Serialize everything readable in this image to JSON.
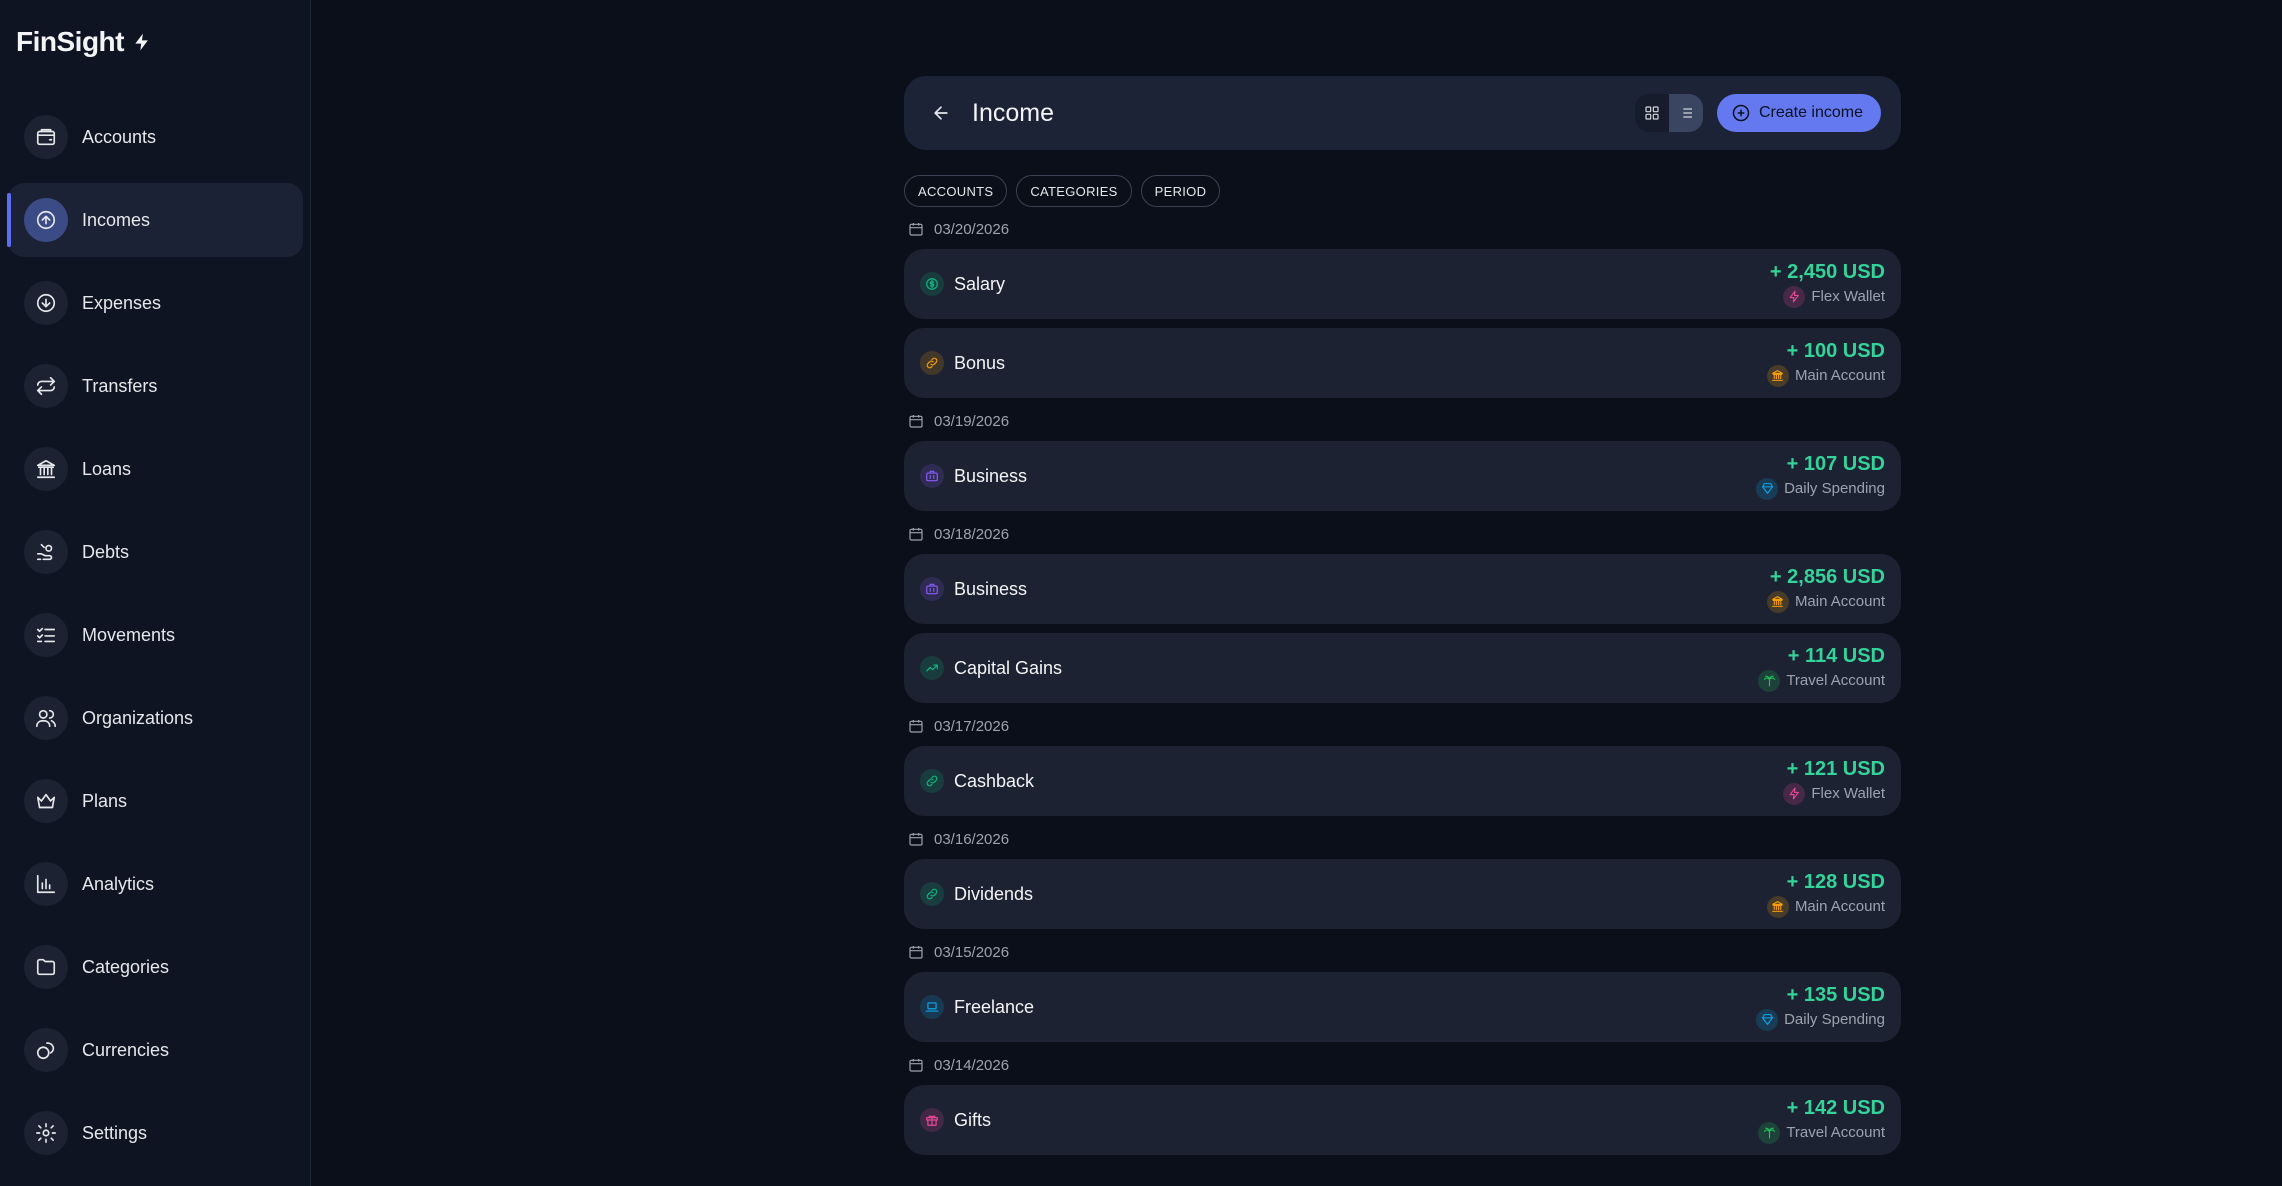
{
  "app": {
    "name": "FinSight"
  },
  "sidebar": {
    "items": [
      {
        "label": "Accounts",
        "icon": "wallet-icon",
        "active": false
      },
      {
        "label": "Incomes",
        "icon": "arrow-up-circle-icon",
        "active": true
      },
      {
        "label": "Expenses",
        "icon": "arrow-down-circle-icon",
        "active": false
      },
      {
        "label": "Transfers",
        "icon": "transfer-icon",
        "active": false
      },
      {
        "label": "Loans",
        "icon": "bank-icon",
        "active": false
      },
      {
        "label": "Debts",
        "icon": "hand-coins-icon",
        "active": false
      },
      {
        "label": "Movements",
        "icon": "list-checks-icon",
        "active": false
      },
      {
        "label": "Organizations",
        "icon": "users-icon",
        "active": false
      },
      {
        "label": "Plans",
        "icon": "crown-icon",
        "active": false
      },
      {
        "label": "Analytics",
        "icon": "bar-chart-icon",
        "active": false
      },
      {
        "label": "Categories",
        "icon": "folder-icon",
        "active": false
      },
      {
        "label": "Currencies",
        "icon": "coins-icon",
        "active": false
      },
      {
        "label": "Settings",
        "icon": "gear-icon",
        "active": false
      }
    ]
  },
  "header": {
    "title": "Income",
    "create_label": "Create income",
    "view_mode": "list"
  },
  "filters": [
    "ACCOUNTS",
    "CATEGORIES",
    "PERIOD"
  ],
  "groups": [
    {
      "date": "03/20/2026",
      "items": [
        {
          "name": "Salary",
          "amount": "+ 2,450 USD",
          "account": "Flex Wallet",
          "cat_icon": "dollar-icon",
          "cat_color": "#10b981",
          "acc_icon": "zap-icon",
          "acc_color": "#ec4899"
        },
        {
          "name": "Bonus",
          "amount": "+ 100 USD",
          "account": "Main Account",
          "cat_icon": "link-icon",
          "cat_color": "#f59e0b",
          "acc_icon": "bank-icon",
          "acc_color": "#f59e0b"
        }
      ]
    },
    {
      "date": "03/19/2026",
      "items": [
        {
          "name": "Business",
          "amount": "+ 107 USD",
          "account": "Daily Spending",
          "cat_icon": "briefcase-icon",
          "cat_color": "#8b5cf6",
          "acc_icon": "diamond-icon",
          "acc_color": "#0ea5e9"
        }
      ]
    },
    {
      "date": "03/18/2026",
      "items": [
        {
          "name": "Business",
          "amount": "+ 2,856 USD",
          "account": "Main Account",
          "cat_icon": "briefcase-icon",
          "cat_color": "#8b5cf6",
          "acc_icon": "bank-icon",
          "acc_color": "#f59e0b"
        },
        {
          "name": "Capital Gains",
          "amount": "+ 114 USD",
          "account": "Travel Account",
          "cat_icon": "trending-up-icon",
          "cat_color": "#10b981",
          "acc_icon": "palm-tree-icon",
          "acc_color": "#22c55e"
        }
      ]
    },
    {
      "date": "03/17/2026",
      "items": [
        {
          "name": "Cashback",
          "amount": "+ 121 USD",
          "account": "Flex Wallet",
          "cat_icon": "link-icon",
          "cat_color": "#10b981",
          "acc_icon": "zap-icon",
          "acc_color": "#ec4899"
        }
      ]
    },
    {
      "date": "03/16/2026",
      "items": [
        {
          "name": "Dividends",
          "amount": "+ 128 USD",
          "account": "Main Account",
          "cat_icon": "link-icon",
          "cat_color": "#10b981",
          "acc_icon": "bank-icon",
          "acc_color": "#f59e0b"
        }
      ]
    },
    {
      "date": "03/15/2026",
      "items": [
        {
          "name": "Freelance",
          "amount": "+ 135 USD",
          "account": "Daily Spending",
          "cat_icon": "laptop-icon",
          "cat_color": "#0ea5e9",
          "acc_icon": "diamond-icon",
          "acc_color": "#0ea5e9"
        }
      ]
    },
    {
      "date": "03/14/2026",
      "items": [
        {
          "name": "Gifts",
          "amount": "+ 142 USD",
          "account": "Travel Account",
          "cat_icon": "gift-icon",
          "cat_color": "#ec4899",
          "acc_icon": "palm-tree-icon",
          "acc_color": "#22c55e"
        }
      ]
    }
  ]
}
